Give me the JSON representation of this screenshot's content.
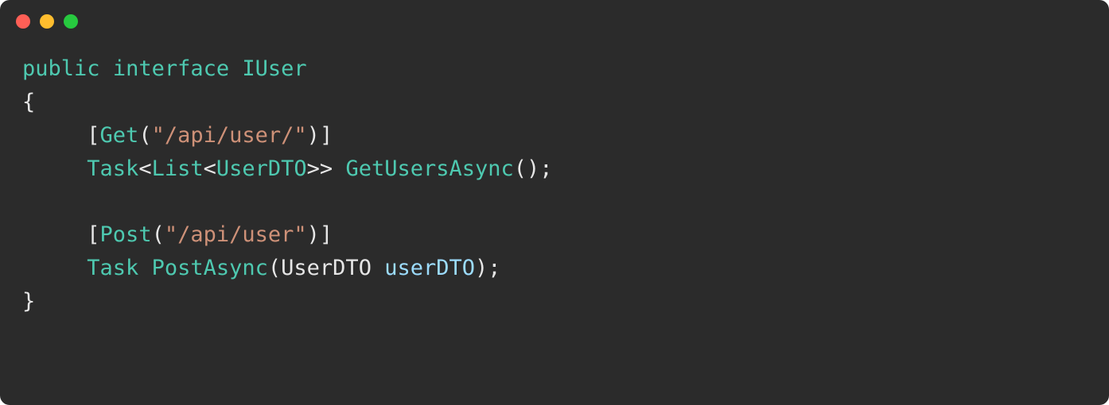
{
  "code": {
    "line1": {
      "kw_public": "public",
      "kw_interface": "interface",
      "name": "IUser"
    },
    "line2": "{",
    "line3": {
      "indent": "     ",
      "lbracket": "[",
      "attr": "Get",
      "lparen": "(",
      "str": "\"/api/user/\"",
      "rparen": ")",
      "rbracket": "]"
    },
    "line4": {
      "indent": "     ",
      "type_task": "Task",
      "lt1": "<",
      "type_list": "List",
      "lt2": "<",
      "type_dto": "UserDTO",
      "gt2": ">>",
      "space": " ",
      "method": "GetUsersAsync",
      "parens": "();"
    },
    "line5": "",
    "line6": {
      "indent": "     ",
      "lbracket": "[",
      "attr": "Post",
      "lparen": "(",
      "str": "\"/api/user\"",
      "rparen": ")",
      "rbracket": "]"
    },
    "line7": {
      "indent": "     ",
      "type_task": "Task",
      "space": " ",
      "method": "PostAsync",
      "lparen": "(",
      "param_type": "UserDTO",
      "space2": " ",
      "param_name": "userDTO",
      "rparen": ");"
    },
    "line8": "}"
  }
}
